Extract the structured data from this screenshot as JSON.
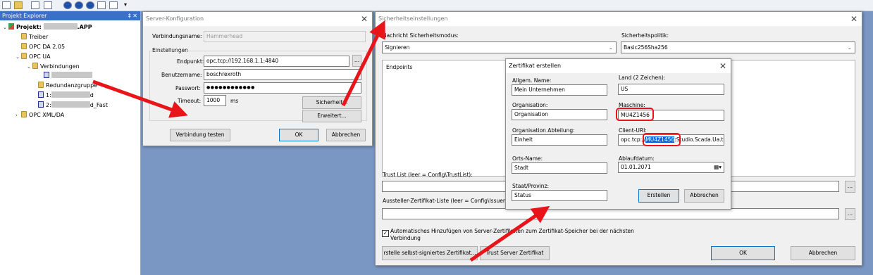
{
  "toolbar": {
    "icons": [
      "new-file-icon",
      "open-icon",
      "tools-icon",
      "save-icon",
      "circle-icon",
      "gear-circle-icon",
      "stop-icon",
      "wand-icon",
      "connect-icon",
      "dropdown-icon"
    ]
  },
  "explorer": {
    "title": "Projekt Explorer",
    "pins": "‡ ✕",
    "project": "Projekt: ",
    "project_suffix": ".APP",
    "treiber": "Treiber",
    "opc_da": "OPC DA 2.05",
    "opc_ua": "OPC UA",
    "verbindungen": "Verbindungen",
    "redundanz": "Redundanzgruppe",
    "conn1_prefix": "1:",
    "conn1_suffix": "d",
    "conn2_prefix": "2:",
    "conn2_suffix": "d_Fast",
    "opc_xml": "OPC XML/DA"
  },
  "server_dialog": {
    "title": "Server-Konfiguration",
    "close": "✕",
    "name_label": "Verbindungsname:",
    "name_value": "Hammerhead",
    "settings_label": "Einstellungen",
    "endpoint_label": "Endpunkt:",
    "endpoint_value": "opc.tcp://192.168.1.1:4840",
    "browse": "...",
    "user_label": "Benutzername:",
    "user_value": "boschrexroth",
    "password_label": "Passwort:",
    "password_value": "●●●●●●●●●●●●",
    "timeout_label": "Timeout:",
    "timeout_value": "1000",
    "timeout_unit": "ms",
    "security_button": "Sicherheit...",
    "advanced_button": "Erweitert...",
    "test_button": "Verbindung testen",
    "ok_button": "OK",
    "cancel_button": "Abbrechen"
  },
  "security_dialog": {
    "title": "Sicherheitseinstellungen",
    "close": "✕",
    "mode_label": "Nachricht Sicherheitsmodus:",
    "mode_value": "Signieren",
    "policy_label": "Sicherheitspolitik:",
    "policy_value": "Basic256Sha256",
    "endpoints_label": "Endpoints",
    "trust_label": "Trust List (leer = Config\\TrustList):",
    "issuer_label": "Aussteller-Zertifikat-Liste (leer = Config\\IssuerList):",
    "browse": "...",
    "auto_add_text": "Automatisches Hinzufügen von Server-Zertifikaten zum Zertifikat-Speicher bei der nächsten Verbindung",
    "self_signed_button": "rstelle selbst-signiertes Zertifikat...",
    "trust_server_button": "Trust Server Zertifikat",
    "ok_button": "OK",
    "cancel_button": "Abbrechen"
  },
  "cert_dialog": {
    "title": "Zertifikat erstellen",
    "close": "✕",
    "common_name_label": "Allgem. Name:",
    "common_name_value": "Mein Unternehmen",
    "country_label": "Land (2 Zeichen):",
    "country_value": "US",
    "org_label": "Organisation:",
    "org_value": "Organisation",
    "machine_label": "Maschine:",
    "machine_value": "MU4Z1456",
    "org_unit_label": "Organisation Abteilung:",
    "org_unit_value": "Einheit",
    "client_uri_label": "Client-URI:",
    "client_uri_prefix": "opc.tcp://",
    "client_uri_highlight": "MU4Z1456",
    "client_uri_suffix": ":Studio.Scada.Ua.t",
    "locality_label": "Orts-Name:",
    "locality_value": "Stadt",
    "expiry_label": "Ablaufdatum:",
    "expiry_value": "01.01.2071",
    "state_label": "Staat/Provinz:",
    "state_value": "Status",
    "create_button": "Erstellen",
    "cancel_button": "Abbrechen"
  },
  "colors": {
    "accent": "#0078d7",
    "annotation": "#e8141a",
    "desktop": "#7a97c4",
    "explorer_title": "#3b6fc8"
  }
}
